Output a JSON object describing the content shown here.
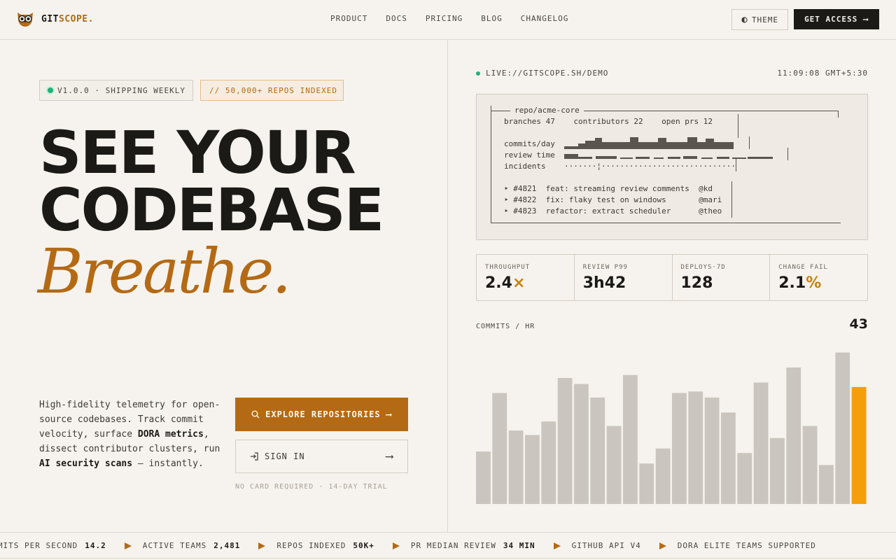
{
  "nav": {
    "brand_main": "GIT",
    "brand_accent": "SCOPE.",
    "links": [
      "PRODUCT",
      "DOCS",
      "PRICING",
      "BLOG",
      "CHANGELOG"
    ],
    "theme_label": "THEME",
    "access_label": "GET ACCESS",
    "arrow": "⟶"
  },
  "hero": {
    "badge_version": "V1.0.0 · SHIPPING WEEKLY",
    "badge_repos": "// 50,000+ REPOS INDEXED",
    "line1": "SEE YOUR",
    "line2": "CODEBASE",
    "line3": "Breathe.",
    "desc_1": "High-fidelity telemetry for open-source codebases. Track commit velocity, surface ",
    "desc_bold_1": "DORA metrics",
    "desc_2": ", dissect contributor clusters, run ",
    "desc_bold_2": "AI security scans",
    "desc_3": " — instantly.",
    "explore_label": "EXPLORE REPOSITORIES",
    "signin_label": "SIGN IN",
    "note": "NO CARD REQUIRED · 14-DAY TRIAL"
  },
  "panel": {
    "live_label": "LIVE://GITSCOPE.SH/DEMO",
    "clock": "11:09:08 GMT+5:30",
    "terminal": {
      "title": "repo/acme-core",
      "row_stats": "branches 47    contributors 22    open prs 12",
      "commits_label": "commits/day",
      "review_label": "review time",
      "incidents_label": "incidents",
      "incidents_dots": "·······¦·····························",
      "prs": [
        "‣ #4821  feat: streaming review comments  @kd",
        "‣ #4822  fix: flaky test on windows       @mari",
        "‣ #4823  refactor: extract scheduler      @theo"
      ]
    },
    "stats": [
      {
        "label": "THROUGHPUT",
        "value": "2.4",
        "unit": "×"
      },
      {
        "label": "REVIEW P99",
        "value": "3h42",
        "unit": ""
      },
      {
        "label": "DEPLOYS·7D",
        "value": "128",
        "unit": ""
      },
      {
        "label": "CHANGE FAIL",
        "value": "2.1",
        "unit": "%"
      }
    ],
    "chart_label": "COMMITS / HR",
    "chart_count": "43"
  },
  "chart_data": {
    "type": "bar",
    "values": [
      35,
      74,
      49,
      46,
      55,
      84,
      80,
      71,
      52,
      86,
      27,
      37,
      74,
      75,
      71,
      61,
      34,
      81,
      44,
      91,
      52,
      26,
      101,
      78
    ],
    "ylim": [
      0,
      105
    ],
    "bar_color": "#cac6bf",
    "highlight_color": "#f59e0b",
    "highlight_index": 23
  },
  "ticker": [
    {
      "label": "COMMITS PER SECOND",
      "value": "14.2"
    },
    {
      "label": "ACTIVE TEAMS",
      "value": "2,481"
    },
    {
      "label": "REPOS INDEXED",
      "value": "50K+"
    },
    {
      "label": "PR MEDIAN REVIEW",
      "value": "34 MIN"
    },
    {
      "label": "GITHUB API V4",
      "value": ""
    },
    {
      "label": "DORA ELITE TEAMS SUPPORTED",
      "value": ""
    }
  ],
  "colors": {
    "accent": "#b46a14",
    "live_green": "#22b07a"
  }
}
